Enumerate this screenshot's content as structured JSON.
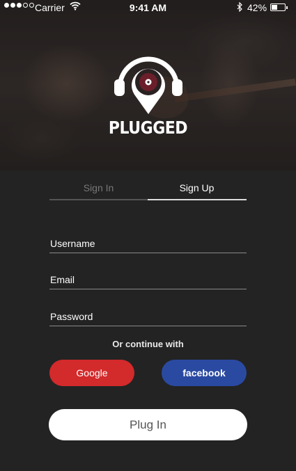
{
  "status_bar": {
    "carrier": "Carrier",
    "time": "9:41 AM",
    "battery": "42%",
    "battery_level": 0.42,
    "signal_bars": 3
  },
  "brand": {
    "name": "PLUGGED"
  },
  "tabs": [
    {
      "label": "Sign In",
      "active": false
    },
    {
      "label": "Sign Up",
      "active": true
    }
  ],
  "form": {
    "username_placeholder": "Username",
    "email_placeholder": "Email",
    "password_placeholder": "Password"
  },
  "social": {
    "prompt": "Or continue with",
    "google_label": "Google",
    "facebook_label": "facebook"
  },
  "submit_label": "Plug In",
  "colors": {
    "background": "#232323",
    "google": "#d32a2b",
    "facebook": "#2a4aa2",
    "submit": "#ffffff"
  }
}
